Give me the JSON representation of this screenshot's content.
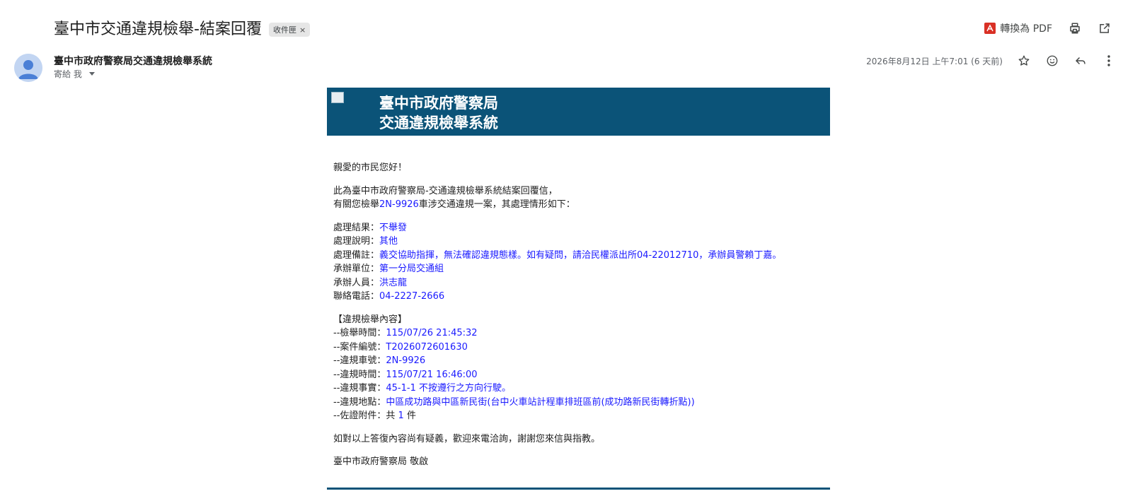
{
  "subject": {
    "title": "臺中市交通違規檢舉-結案回覆",
    "label": "收件匣",
    "label_close": "×"
  },
  "toolbar": {
    "pdf_label": "轉換為 PDF",
    "pdf_icon": "pdf-icon",
    "print_icon": "print-icon",
    "open_new_window_icon": "open-in-new-icon"
  },
  "sender": {
    "name": "臺中市政府警察局交通違規檢舉系統",
    "to": "寄給 我",
    "date": "2026年8月12日 上午7:01 (6 天前)"
  },
  "banner": {
    "line1": "臺中市政府警察局",
    "line2": "交通違規檢舉系統",
    "color": "#0b5378"
  },
  "body": {
    "greeting": "親愛的市民您好！",
    "intro1": "此為臺中市政府警察局-交通違規檢舉系統結案回覆信，",
    "intro2_pre": "有關您檢舉",
    "intro2_plate": "2N-9926",
    "intro2_post": "車涉交通違規一案，其處理情形如下：",
    "result_label": "處理結果：",
    "result_value": "不舉發",
    "explain_label": "處理說明：",
    "explain_value": "其他",
    "note_label": "處理備註：",
    "note_value": "義交協助指揮，無法確認違規態樣。如有疑問，請洽民權派出所04-22012710，承辦員警賴丁嘉。",
    "unit_label": "承辦單位：",
    "unit_value": "第一分局交通組",
    "officer_label": "承辦人員：",
    "officer_value": "洪志龍",
    "phone_label": "聯絡電話：",
    "phone_value": "04-2227-2666",
    "section_title": "【違規檢舉內容】",
    "report_time_label": "--檢舉時間：",
    "report_time_value": "115/07/26 21:45:32",
    "case_no_label": "--案件編號：",
    "case_no_value": "T2026072601630",
    "plate_label": "--違規車號：",
    "plate_value": "2N-9926",
    "violation_time_label": "--違規時間：",
    "violation_time_value": "115/07/21 16:46:00",
    "fact_label": "--違規事實：",
    "fact_value": "45-1-1 不按遵行之方向行駛。",
    "place_label": "--違規地點：",
    "place_value": "中區成功路與中區新民街(台中火車站計程車排班區前(成功路新民街轉折點))",
    "attach_label": "--佐證附件：",
    "attach_pre": "共 ",
    "attach_count": "1",
    "attach_post": " 件",
    "closing": "如對以上答復內容尚有疑義，歡迎來電洽詢，謝謝您來信與指教。",
    "signature": "臺中市政府警察局 敬啟"
  }
}
